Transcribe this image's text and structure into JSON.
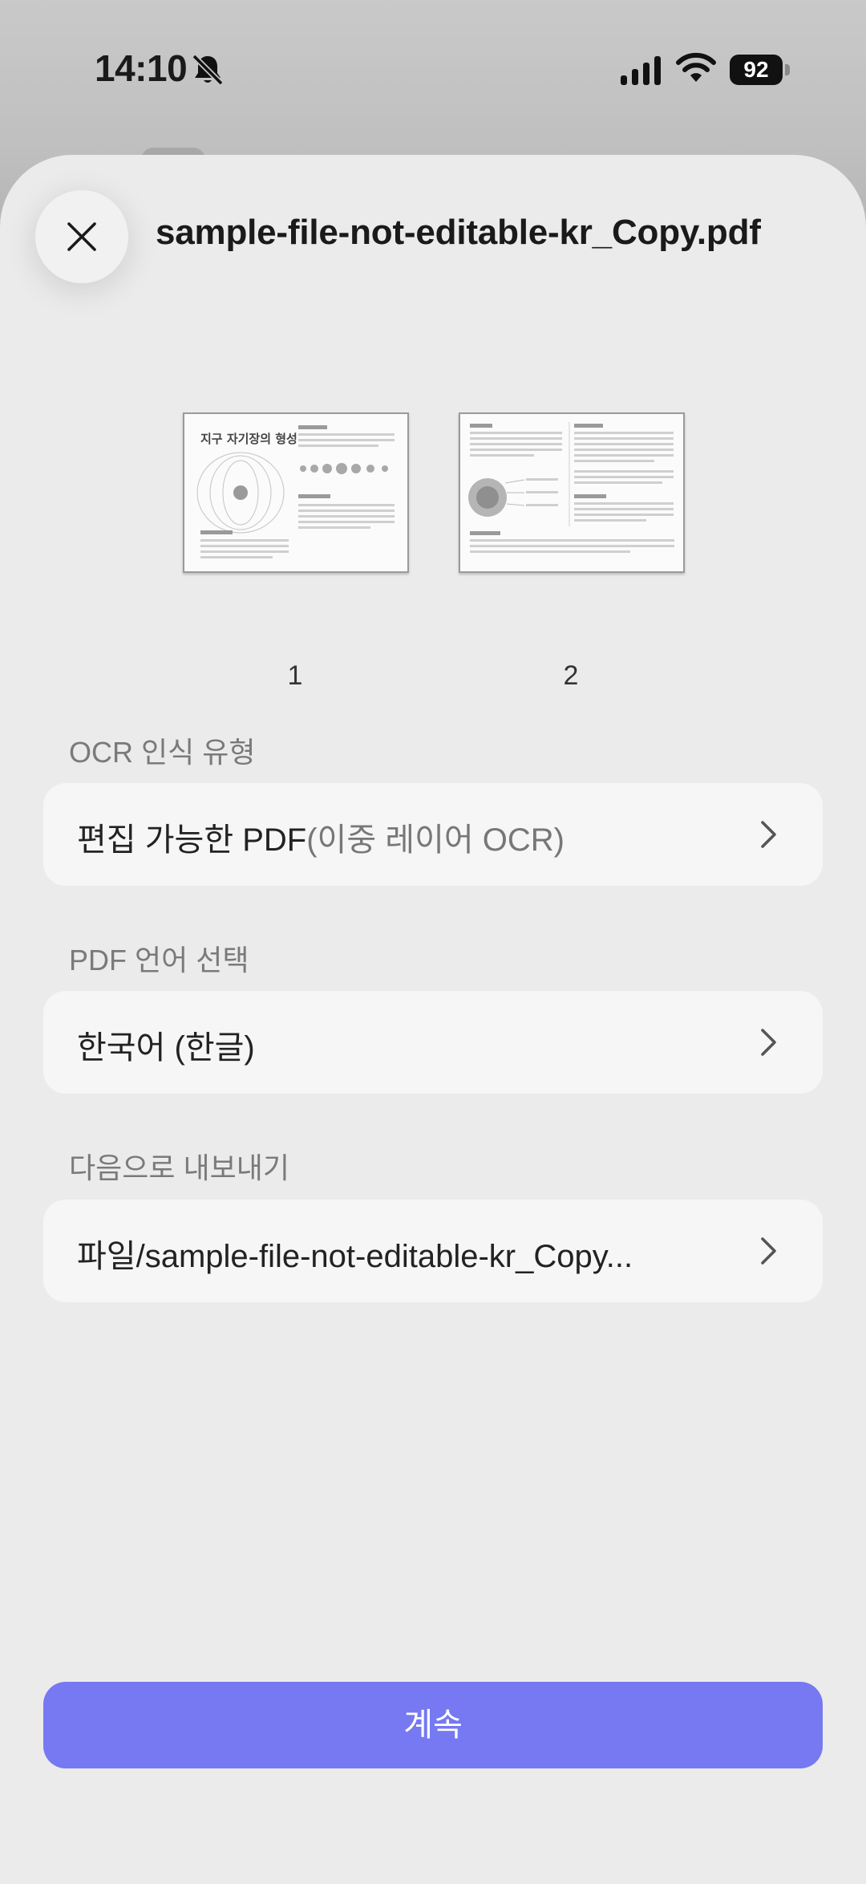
{
  "status_bar": {
    "time": "14:10",
    "battery": "92",
    "icons": [
      "bell-slash-icon",
      "cellular-signal-icon",
      "wifi-icon",
      "battery-icon"
    ]
  },
  "sheet": {
    "file_name": "sample-file-not-editable-kr_Copy.pdf",
    "close_icon": "close-icon",
    "pages": [
      {
        "number": "1",
        "heading": "지구 자기장의 형성"
      },
      {
        "number": "2"
      }
    ]
  },
  "ocr_type": {
    "label": "OCR 인식 유형",
    "value_main": "편집 가능한 PDF",
    "value_sub": "(이중 레이어 OCR)"
  },
  "language": {
    "label": "PDF 언어 선택",
    "value": "한국어 (한글)"
  },
  "export": {
    "label": "다음으로 내보내기",
    "value": "파일/sample-file-not-editable-kr_Copy..."
  },
  "continue_label": "계속",
  "colors": {
    "accent": "#7679F1",
    "sheet_bg": "#EBEBEB",
    "row_bg": "#F6F6F6"
  }
}
